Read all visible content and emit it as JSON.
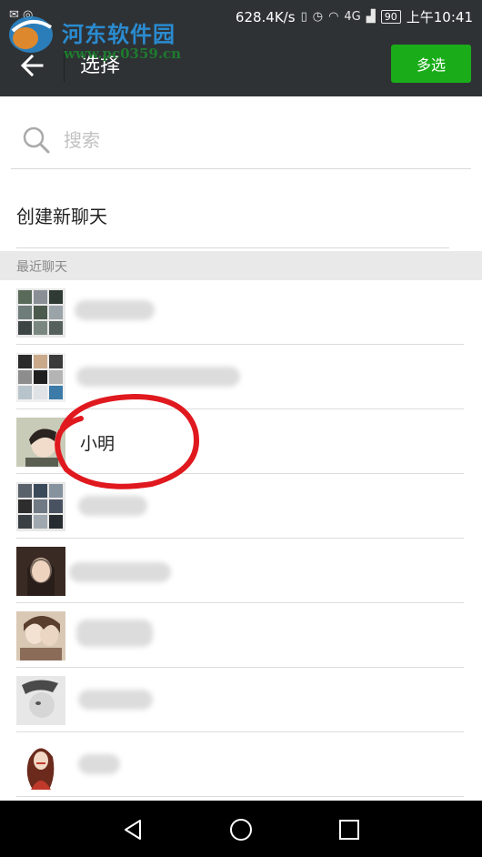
{
  "status_bar": {
    "speed": "628.4K/s",
    "network": "4G",
    "battery": "90",
    "time": "上午10:41"
  },
  "watermark": {
    "title": "河东软件园",
    "url": "www.pc0359.cn"
  },
  "header": {
    "title": "选择",
    "multi_select_label": "多选"
  },
  "search": {
    "placeholder": "搜索"
  },
  "create_chat_label": "创建新聊天",
  "section_header": "最近聊天",
  "contacts": [
    {
      "name": "",
      "avatar": "group-photo-avatar",
      "obscured": true
    },
    {
      "name": "",
      "avatar": "group-photo-avatar",
      "obscured": true
    },
    {
      "name": "小明",
      "avatar": "person-photo-avatar",
      "obscured": false,
      "annotated": true
    },
    {
      "name": "",
      "avatar": "group-photo-avatar",
      "obscured": true
    },
    {
      "name": "",
      "avatar": "person-photo-avatar",
      "obscured": true
    },
    {
      "name": "",
      "avatar": "person-photo-avatar",
      "obscured": true
    },
    {
      "name": "",
      "avatar": "person-photo-avatar",
      "obscured": true
    },
    {
      "name": "",
      "avatar": "illustration-avatar",
      "obscured": true
    }
  ],
  "colors": {
    "title_bar": "#2f3235",
    "accent_green": "#1aad19",
    "annotation_red": "#e0191f",
    "section_bg": "#e9e9e9"
  }
}
